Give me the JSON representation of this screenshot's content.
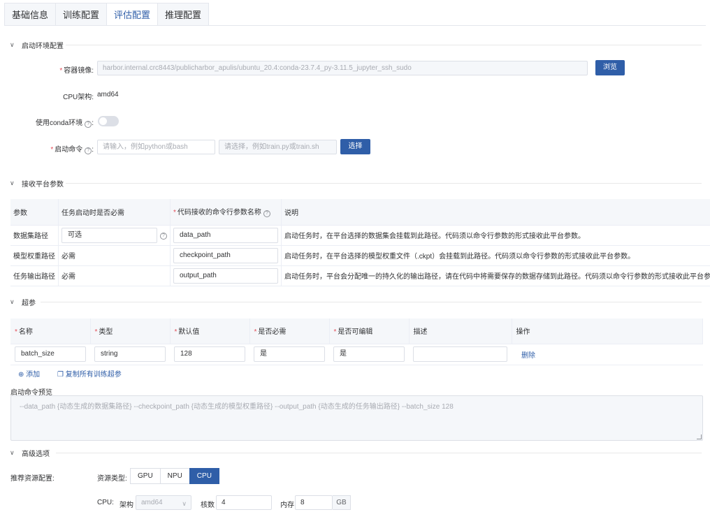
{
  "tabs": [
    "基础信息",
    "训练配置",
    "评估配置",
    "推理配置"
  ],
  "sections": {
    "env": "启动环境配置",
    "params": "接收平台参数",
    "hyper": "超参",
    "advanced": "高级选项"
  },
  "env": {
    "image_label": "容器镜像:",
    "image_value": "harbor.internal.crc8443/publicharbor_apulis/ubuntu_20.4:conda-23.7.4_py-3.11.5_jupyter_ssh_sudo",
    "browse": "浏览",
    "cpu_arch_label": "CPU架构:",
    "cpu_arch_value": "amd64",
    "conda_label": "使用conda环境",
    "cmd_label": "启动命令",
    "cmd_placeholder": "请输入，例如python或bash",
    "script_placeholder": "请选择，例如train.py或train.sh",
    "select": "选择"
  },
  "params_table": {
    "headers": [
      "参数",
      "任务启动时是否必需",
      "代码接收的命令行参数名称",
      "说明"
    ],
    "rows": [
      {
        "param": "数据集路径",
        "required": "可选",
        "name": "data_path",
        "desc": "启动任务时，在平台选择的数据集会挂载到此路径。代码须以命令行参数的形式接收此平台参数。"
      },
      {
        "param": "模型权重路径",
        "required": "必需",
        "name": "checkpoint_path",
        "desc": "启动任务时，在平台选择的模型权重文件（.ckpt）会挂载到此路径。代码须以命令行参数的形式接收此平台参数。"
      },
      {
        "param": "任务输出路径",
        "required": "必需",
        "name": "output_path",
        "desc": "启动任务时，平台会分配唯一的持久化的输出路径，请在代码中将需要保存的数据存储到此路径。代码须以命令行参数的形式接收此平台参数。"
      }
    ]
  },
  "hyper_table": {
    "headers": [
      "名称",
      "类型",
      "默认值",
      "是否必需",
      "是否可编辑",
      "描述",
      "操作"
    ],
    "row": {
      "name": "batch_size",
      "type": "string",
      "default": "128",
      "required": "是",
      "editable": "是",
      "desc": "",
      "action": "删除"
    },
    "add": "添加",
    "copy": "复制所有训练超参"
  },
  "preview": {
    "label": "启动命令预览",
    "text": "--data_path {动态生成的数据集路径} --checkpoint_path {动态生成的模型权重路径} --output_path {动态生成的任务输出路径} --batch_size 128"
  },
  "advanced": {
    "resource_label": "推荐资源配置:",
    "type_label": "资源类型:",
    "types": [
      "GPU",
      "NPU",
      "CPU"
    ],
    "active_type": "CPU",
    "cpu_label": "CPU:",
    "arch_label": "架构",
    "arch_value": "amd64",
    "cores_label": "核数",
    "cores_value": "4",
    "mem_label": "内存",
    "mem_value": "8",
    "mem_unit": "GB"
  }
}
